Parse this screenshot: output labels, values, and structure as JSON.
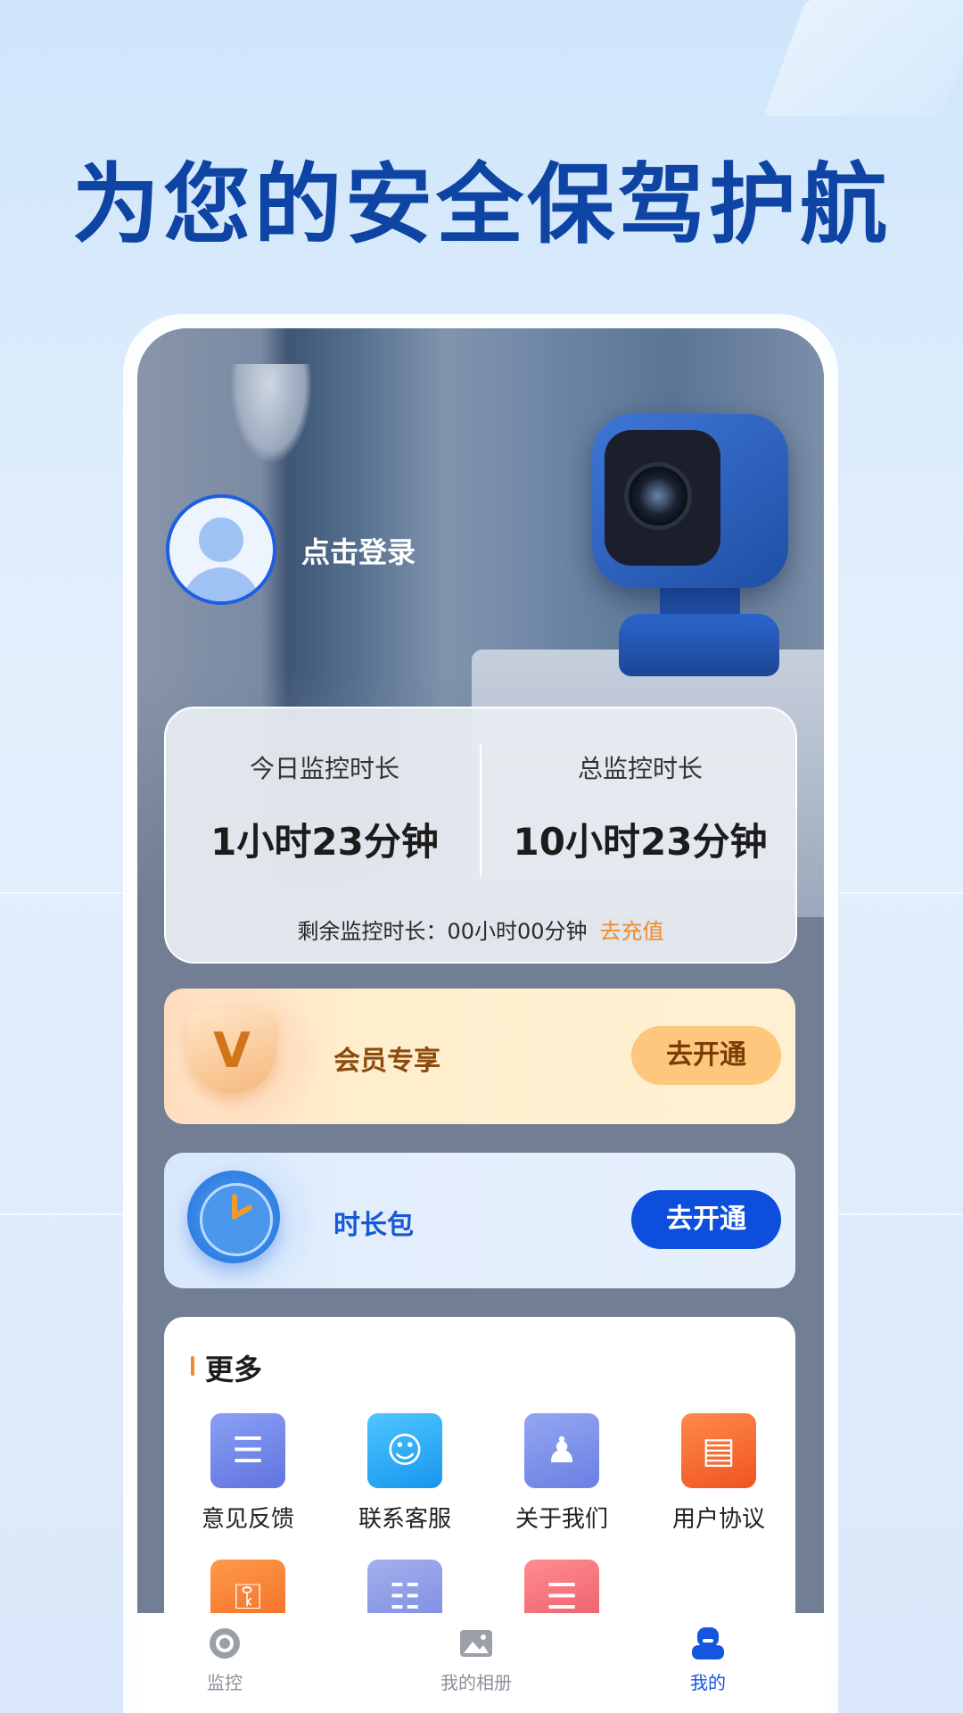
{
  "headline": "为您的安全保驾护航",
  "profile": {
    "login_text": "点击登录"
  },
  "stats": {
    "today_label": "今日监控时长",
    "today_value": "1小时23分钟",
    "total_label": "总监控时长",
    "total_value": "10小时23分钟",
    "remaining_label": "剩余监控时长：",
    "remaining_value": "00小时00分钟",
    "recharge_link": "去充值"
  },
  "member_card": {
    "title": "会员专享",
    "button": "去开通"
  },
  "duration_card": {
    "title": "时长包",
    "button": "去开通"
  },
  "more": {
    "title": "更多",
    "items": [
      {
        "label": "意见反馈",
        "icon": "feedback-icon",
        "color": "#6f86e8"
      },
      {
        "label": "联系客服",
        "icon": "customer-service-icon",
        "color": "#27aef5"
      },
      {
        "label": "关于我们",
        "icon": "about-us-icon",
        "color": "#7890ea"
      },
      {
        "label": "用户协议",
        "icon": "user-agreement-icon",
        "color": "#f4672d"
      },
      {
        "label": "",
        "icon": "key-icon",
        "color": "#f57a2f"
      },
      {
        "label": "",
        "icon": "clipboard-icon",
        "color": "#8d9be6"
      },
      {
        "label": "",
        "icon": "layers-icon",
        "color": "#f06f7a"
      }
    ]
  },
  "tabbar": {
    "tabs": [
      {
        "label": "监控",
        "icon": "camera-icon",
        "active": false
      },
      {
        "label": "我的相册",
        "icon": "album-icon",
        "active": false
      },
      {
        "label": "我的",
        "icon": "profile-icon",
        "active": true
      }
    ],
    "active_color": "#1456dd",
    "inactive_color": "#8a8f99"
  }
}
